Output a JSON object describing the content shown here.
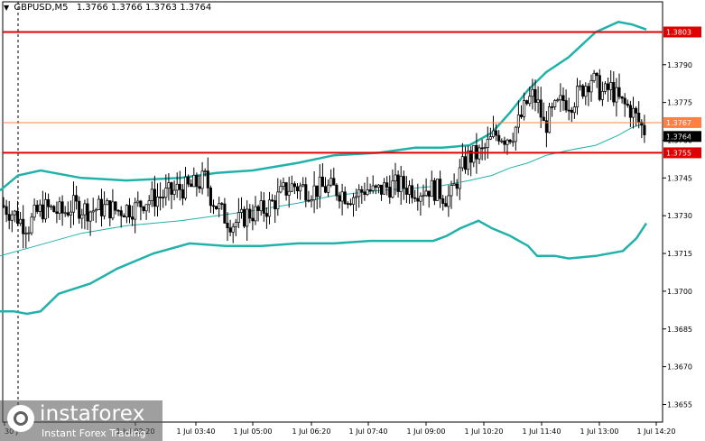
{
  "header": {
    "symbol": "GBPUSD,M5",
    "ohlc": "1.3766 1.3766 1.3763 1.3764"
  },
  "colors": {
    "band": "#20b2aa",
    "middle": "#20b2aa",
    "level": "#e00000",
    "price_line": "#ff8040",
    "candle": "#000000"
  },
  "logo": {
    "name": "instaforex",
    "tagline": "Instant Forex Trading"
  },
  "chart_data": {
    "type": "candlestick",
    "title": "GBPUSD,M5",
    "ylim": [
      1.3648,
      1.3815
    ],
    "y_ticks": [
      "1.3790",
      "1.3775",
      "1.3760",
      "1.3745",
      "1.3730",
      "1.3715",
      "1.3700",
      "1.3685",
      "1.3670",
      "1.3655"
    ],
    "x_labels": [
      "30 J",
      "1 Jul 02:20",
      "1 Jul 03:40",
      "1 Jul 05:00",
      "1 Jul 06:20",
      "1 Jul 07:40",
      "1 Jul 09:00",
      "1 Jul 10:20",
      "1 Jul 11:40",
      "1 Jul 13:00",
      "1 Jul 14:20"
    ],
    "levels": [
      {
        "value": 1.3803,
        "label": "1.3803"
      },
      {
        "value": 1.3755,
        "label": "1.3755"
      }
    ],
    "price_levels": [
      {
        "value": 1.3767,
        "label": "1.3767"
      },
      {
        "value": 1.3764,
        "label": "1.3764"
      }
    ],
    "bollinger_upper": [
      [
        0,
        1.374
      ],
      [
        20,
        1.3746
      ],
      [
        45,
        1.3748
      ],
      [
        90,
        1.3745
      ],
      [
        140,
        1.3744
      ],
      [
        200,
        1.3745
      ],
      [
        240,
        1.3747
      ],
      [
        280,
        1.3748
      ],
      [
        330,
        1.3751
      ],
      [
        370,
        1.3754
      ],
      [
        420,
        1.3755
      ],
      [
        460,
        1.3757
      ],
      [
        490,
        1.3757
      ],
      [
        520,
        1.3758
      ],
      [
        545,
        1.3763
      ],
      [
        565,
        1.3771
      ],
      [
        585,
        1.378
      ],
      [
        605,
        1.3787
      ],
      [
        630,
        1.3793
      ],
      [
        660,
        1.3803
      ],
      [
        685,
        1.3807
      ],
      [
        700,
        1.3806
      ],
      [
        716,
        1.3804
      ]
    ],
    "bollinger_middle": [
      [
        0,
        1.3714
      ],
      [
        40,
        1.3718
      ],
      [
        90,
        1.3723
      ],
      [
        140,
        1.3726
      ],
      [
        200,
        1.3728
      ],
      [
        240,
        1.373
      ],
      [
        280,
        1.3732
      ],
      [
        330,
        1.3735
      ],
      [
        370,
        1.3738
      ],
      [
        420,
        1.374
      ],
      [
        460,
        1.3741
      ],
      [
        490,
        1.3742
      ],
      [
        520,
        1.3744
      ],
      [
        545,
        1.3746
      ],
      [
        565,
        1.3749
      ],
      [
        585,
        1.3751
      ],
      [
        605,
        1.3754
      ],
      [
        630,
        1.3756
      ],
      [
        660,
        1.3758
      ],
      [
        685,
        1.3762
      ],
      [
        700,
        1.3765
      ],
      [
        716,
        1.3767
      ]
    ],
    "bollinger_lower": [
      [
        0,
        1.3692
      ],
      [
        15,
        1.3692
      ],
      [
        30,
        1.3691
      ],
      [
        45,
        1.3692
      ],
      [
        65,
        1.3699
      ],
      [
        100,
        1.3703
      ],
      [
        130,
        1.3709
      ],
      [
        170,
        1.3715
      ],
      [
        210,
        1.3719
      ],
      [
        250,
        1.3718
      ],
      [
        290,
        1.3718
      ],
      [
        330,
        1.3719
      ],
      [
        370,
        1.3719
      ],
      [
        410,
        1.372
      ],
      [
        450,
        1.372
      ],
      [
        480,
        1.372
      ],
      [
        495,
        1.3722
      ],
      [
        510,
        1.3725
      ],
      [
        530,
        1.3728
      ],
      [
        545,
        1.3725
      ],
      [
        565,
        1.3722
      ],
      [
        585,
        1.3718
      ],
      [
        595,
        1.3714
      ],
      [
        615,
        1.3714
      ],
      [
        630,
        1.3713
      ],
      [
        660,
        1.3714
      ],
      [
        690,
        1.3716
      ],
      [
        705,
        1.3721
      ],
      [
        716,
        1.3727
      ]
    ],
    "price_path": [
      [
        3,
        1.3734
      ],
      [
        10,
        1.3732
      ],
      [
        18,
        1.373
      ],
      [
        25,
        1.3727
      ],
      [
        32,
        1.3726
      ],
      [
        40,
        1.3731
      ],
      [
        50,
        1.3733
      ],
      [
        60,
        1.3732
      ],
      [
        70,
        1.3731
      ],
      [
        80,
        1.3734
      ],
      [
        90,
        1.3733
      ],
      [
        100,
        1.3732
      ],
      [
        110,
        1.3733
      ],
      [
        120,
        1.3733
      ],
      [
        130,
        1.3732
      ],
      [
        140,
        1.3733
      ],
      [
        150,
        1.3733
      ],
      [
        160,
        1.3736
      ],
      [
        170,
        1.3737
      ],
      [
        180,
        1.3738
      ],
      [
        190,
        1.3739
      ],
      [
        200,
        1.3741
      ],
      [
        210,
        1.3741
      ],
      [
        220,
        1.3743
      ],
      [
        228,
        1.3745
      ],
      [
        233,
        1.3738
      ],
      [
        240,
        1.3734
      ],
      [
        250,
        1.3729
      ],
      [
        258,
        1.3727
      ],
      [
        266,
        1.3728
      ],
      [
        275,
        1.3731
      ],
      [
        285,
        1.3731
      ],
      [
        295,
        1.3733
      ],
      [
        305,
        1.3736
      ],
      [
        315,
        1.374
      ],
      [
        325,
        1.3742
      ],
      [
        335,
        1.3741
      ],
      [
        345,
        1.374
      ],
      [
        355,
        1.3741
      ],
      [
        365,
        1.3741
      ],
      [
        375,
        1.374
      ],
      [
        385,
        1.3738
      ],
      [
        395,
        1.3738
      ],
      [
        405,
        1.3741
      ],
      [
        415,
        1.3739
      ],
      [
        425,
        1.3741
      ],
      [
        435,
        1.3742
      ],
      [
        445,
        1.3742
      ],
      [
        455,
        1.3741
      ],
      [
        465,
        1.374
      ],
      [
        475,
        1.3741
      ],
      [
        485,
        1.374
      ],
      [
        495,
        1.3737
      ],
      [
        500,
        1.3738
      ],
      [
        506,
        1.3744
      ],
      [
        512,
        1.3749
      ],
      [
        518,
        1.3753
      ],
      [
        526,
        1.3754
      ],
      [
        534,
        1.3755
      ],
      [
        540,
        1.3758
      ],
      [
        546,
        1.3761
      ],
      [
        552,
        1.3763
      ],
      [
        560,
        1.3761
      ],
      [
        568,
        1.3763
      ],
      [
        576,
        1.3768
      ],
      [
        584,
        1.3775
      ],
      [
        591,
        1.3778
      ],
      [
        597,
        1.3773
      ],
      [
        603,
        1.3765
      ],
      [
        610,
        1.377
      ],
      [
        617,
        1.3773
      ],
      [
        624,
        1.3776
      ],
      [
        632,
        1.3775
      ],
      [
        640,
        1.3778
      ],
      [
        648,
        1.3782
      ],
      [
        655,
        1.3785
      ],
      [
        662,
        1.3781
      ],
      [
        669,
        1.3778
      ],
      [
        676,
        1.3781
      ],
      [
        683,
        1.3777
      ],
      [
        690,
        1.3774
      ],
      [
        697,
        1.3773
      ],
      [
        703,
        1.377
      ],
      [
        708,
        1.3767
      ],
      [
        713,
        1.3764
      ],
      [
        716,
        1.3764
      ]
    ]
  }
}
